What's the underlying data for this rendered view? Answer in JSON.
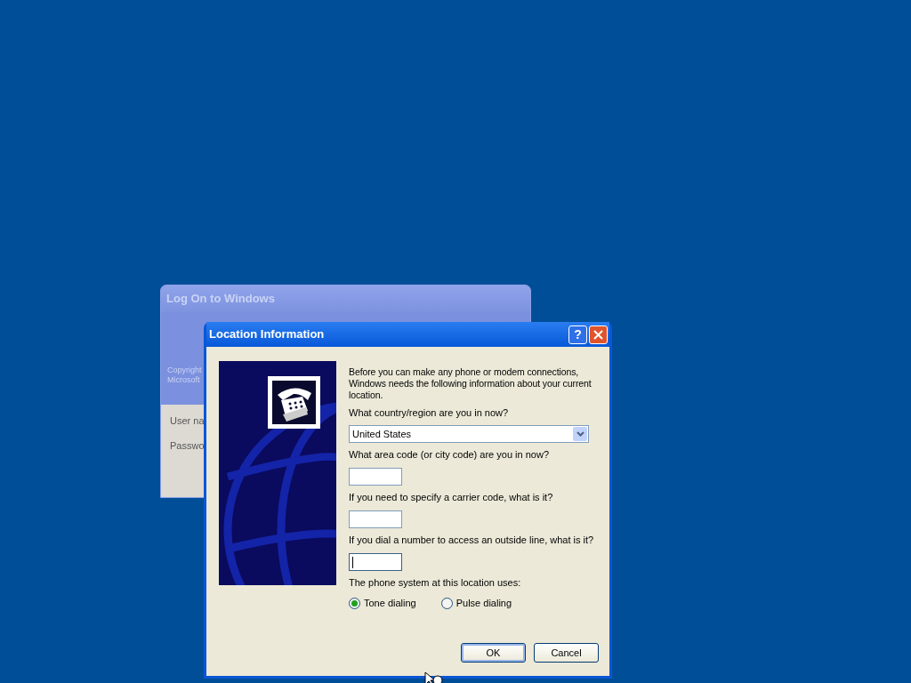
{
  "background_window": {
    "title": "Log On to Windows",
    "copyright_lines": [
      "Copyright",
      "Microsoft"
    ],
    "labels": [
      "User na",
      "Passwo"
    ]
  },
  "dialog": {
    "title": "Location Information",
    "help_button": "?",
    "intro": "Before you can make any phone or modem connections, Windows needs the following information about your current location.",
    "fields": [
      {
        "kind": "dropdown",
        "label": "What country/region are you in now?",
        "value": "United States",
        "focused": false
      },
      {
        "kind": "text",
        "label": "What area code (or city code) are you in now?",
        "focused": false
      },
      {
        "kind": "text",
        "label": "If you need to specify a carrier code, what is it?",
        "focused": false
      },
      {
        "kind": "text",
        "label": "If you dial a number to access an outside line, what is it?",
        "focused": true
      }
    ],
    "dialing_label": "The phone system at this location uses:",
    "dialing_options": [
      {
        "label": "Tone dialing",
        "selected": true
      },
      {
        "label": "Pulse dialing",
        "selected": false
      }
    ],
    "buttons": [
      {
        "label": "OK",
        "default": true
      },
      {
        "label": "Cancel",
        "default": false
      }
    ]
  }
}
